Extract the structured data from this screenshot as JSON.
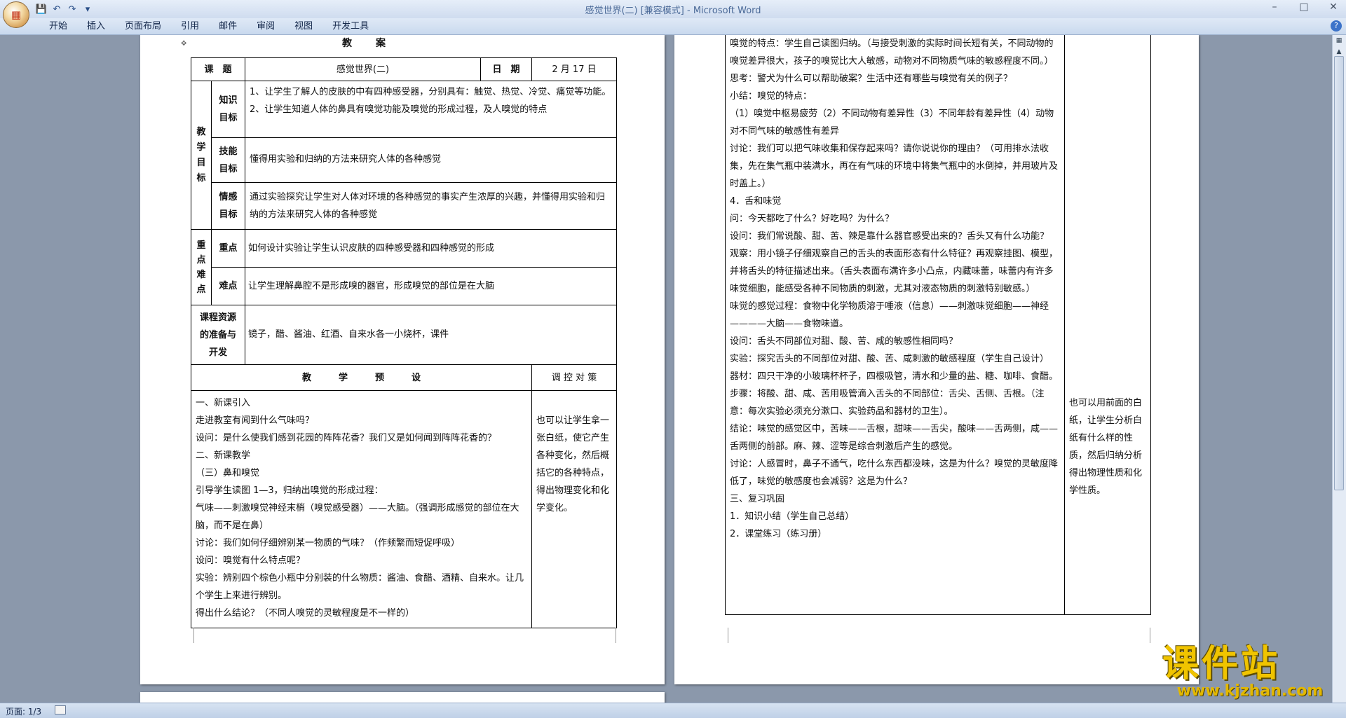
{
  "window": {
    "title": "感觉世界(二) [兼容模式] - Microsoft Word"
  },
  "office_button": {
    "icon": "office-logo"
  },
  "qat": [
    "save-icon",
    "undo-icon",
    "redo-icon",
    "customize-icon"
  ],
  "ribbon": {
    "tabs": [
      "开始",
      "插入",
      "页面布局",
      "引用",
      "邮件",
      "审阅",
      "视图",
      "开发工具"
    ]
  },
  "status": {
    "page": "页面: 1/3"
  },
  "page1": {
    "heading": "教　　案",
    "lesson_label": "课　题",
    "lesson_value": "感觉世界(二)",
    "date_label": "日　期",
    "date_value": "2 月 17 日",
    "goals_label": "教\n学\n目\n标",
    "knowledge_label": "知识\n目标",
    "knowledge_text": "1、让学生了解人的皮肤的中有四种感受器，分别具有：触觉、热觉、冷觉、痛觉等功能。\n2、让学生知道人体的鼻具有嗅觉功能及嗅觉的形成过程，及人嗅觉的特点",
    "skill_label": "技能\n目标",
    "skill_text": "懂得用实验和归纳的方法来研究人体的各种感觉",
    "emotion_label": "情感\n目标",
    "emotion_text": "通过实验探究让学生对人体对环境的各种感觉的事实产生浓厚的兴趣，并懂得用实验和归纳的方法来研究人体的各种感觉",
    "key_label": "重\n点\n难\n点",
    "focus_label": "重点",
    "focus_text": "如何设计实验让学生认识皮肤的四种感受器和四种感觉的形成",
    "difficulty_label": "难点",
    "difficulty_text": "让学生理解鼻腔不是形成嗅的器官，形成嗅觉的部位是在大脑",
    "resources_label": "课程资源\n的准备与\n开发",
    "resources_text": "镜子，醋、酱油、红酒、自来水各一小烧杯，课件",
    "plan_header": "教　　　学　　　预　　　设",
    "control_header": "调 控 对 策",
    "plan_lines": [
      "一、新课引入",
      "走进教室有闻到什么气味吗？",
      "设问：是什么使我们感到花园的阵阵花香？我们又是如何闻到阵阵花香的？",
      "二、新课教学",
      "（三）鼻和嗅觉",
      "引导学生读图 1—3，归纳出嗅觉的形成过程：",
      "气味——刺激嗅觉神经末梢（嗅觉感受器）——大脑。（强调形成感觉的部位在大脑，而不是在鼻）",
      "讨论：我们如何仔细辨别某一物质的气味？（作频繁而短促呼吸）",
      "设问：嗅觉有什么特点呢？",
      "实验：辨别四个棕色小瓶中分别装的什么物质：酱油、食醋、酒精、自来水。让几个学生上来进行辨别。",
      "得出什么结论？（不同人嗅觉的灵敏程度是不一样的）"
    ],
    "control_text": "也可以让学生拿一张白纸，使它产生各种变化，然后概括它的各种特点，得出物理变化和化学变化。"
  },
  "page2": {
    "main_lines": [
      "嗅觉的特点：学生自己读图归纳。（与接受刺激的实际时间长短有关，不同动物的嗅觉差异很大，孩子的嗅觉比大人敏感，动物对不同物质气味的敏感程度不同。）",
      "思考：警犬为什么可以帮助破案？生活中还有哪些与嗅觉有关的例子？",
      "小结：嗅觉的特点：",
      "（1）嗅觉中枢易疲劳（2）不同动物有差异性（3）不同年龄有差异性（4）动物对不同气味的敏感性有差异",
      "讨论：我们可以把气味收集和保存起来吗？请你说说你的理由？（可用排水法收集，先在集气瓶中装满水，再在有气味的环境中将集气瓶中的水倒掉，并用玻片及时盖上。）",
      "4．舌和味觉",
      "问：今天都吃了什么？好吃吗？为什么？",
      "设问：我们常说酸、甜、苦、辣是靠什么器官感受出来的？舌头又有什么功能？",
      "观察：用小镜子仔细观察自己的舌头的表面形态有什么特征？再观察挂图、模型，并将舌头的特征描述出来。（舌头表面布满许多小凸点，内藏味蕾，味蕾内有许多味觉细胞，能感受各种不同物质的刺激，尤其对液态物质的刺激特别敏感。）",
      "味觉的感觉过程：食物中化学物质溶于唾液（信息）——刺激味觉细胞——神经————大脑——食物味道。",
      "设问：舌头不同部位对甜、酸、苦、咸的敏感性相同吗？",
      "实验：探究舌头的不同部位对甜、酸、苦、咸刺激的敏感程度（学生自己设计）",
      "器材：四只干净的小玻璃杯杯子，四根吸管，清水和少量的盐、糖、咖啡、食醋。",
      "步骤：将酸、甜、咸、苦用吸管滴入舌头的不同部位：舌尖、舌侧、舌根。（注意：每次实验必须充分漱口、实验药品和器材的卫生）。",
      "结论：味觉的感觉区中，苦味——舌根，甜味——舌尖，酸味——舌两侧，咸——舌两侧的前部。麻、辣、涩等是综合刺激后产生的感觉。",
      "讨论：人感冒时，鼻子不通气，吃什么东西都没味，这是为什么？嗅觉的灵敏度降低了，味觉的敏感度也会减弱？这是为什么？",
      "三、复习巩固",
      "1．知识小结（学生自己总结）",
      "2．课堂练习（练习册）"
    ],
    "side_text": "也可以用前面的白纸，让学生分析白纸有什么样的性质，然后归纳分析得出物理性质和化学性质。"
  },
  "logo": {
    "big": "课件站",
    "url": "www.kjzhan.com"
  }
}
